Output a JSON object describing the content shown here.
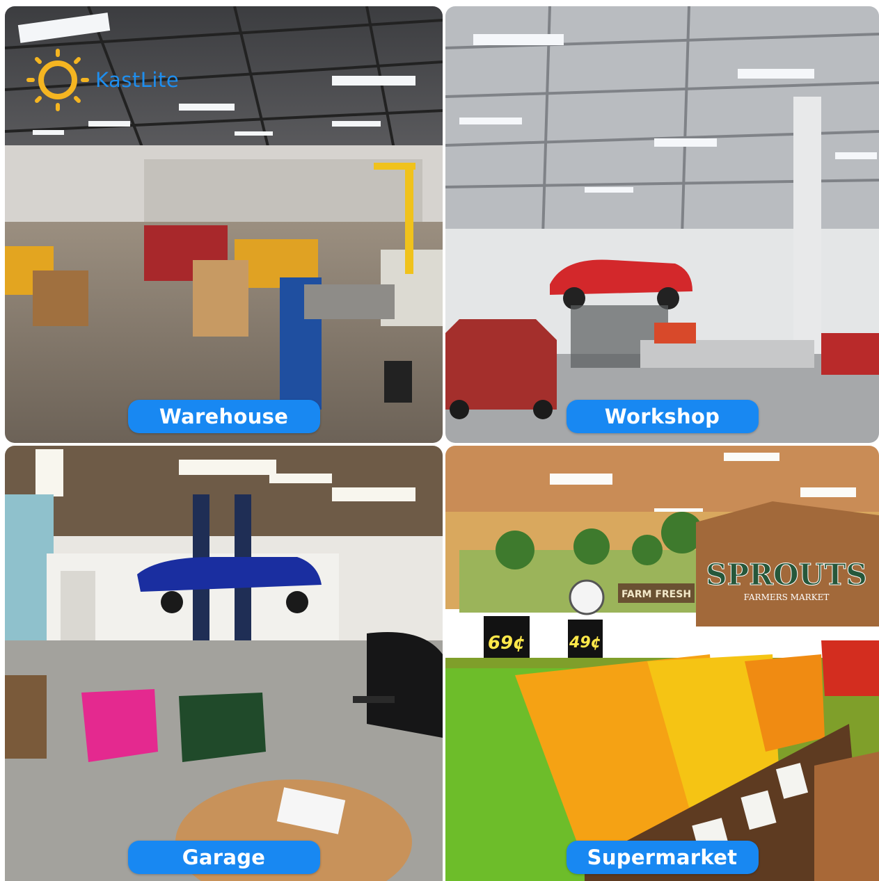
{
  "brand": {
    "name": "KastLite",
    "icon": "sun-icon",
    "sun_color": "#F5B521",
    "text_color": "#1E8EEF"
  },
  "label_color": "#1888F2",
  "tiles": [
    {
      "label": "Warehouse"
    },
    {
      "label": "Workshop"
    },
    {
      "label": "Garage"
    },
    {
      "label": "Supermarket",
      "sign": "SPROUTS",
      "sign_sub": "FARMERS MARKET",
      "banner": "FARM FRESH",
      "price1": "69¢",
      "price2": "49¢"
    }
  ]
}
